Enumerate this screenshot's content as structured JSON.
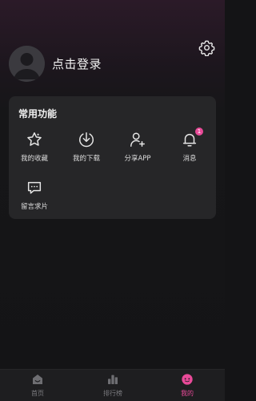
{
  "header": {
    "login_label": "点击登录"
  },
  "features": {
    "title": "常用功能",
    "items": [
      {
        "label": "我的收藏",
        "icon": "star-icon"
      },
      {
        "label": "我的下载",
        "icon": "download-icon"
      },
      {
        "label": "分享APP",
        "icon": "add-user-icon"
      },
      {
        "label": "消息",
        "icon": "bell-icon",
        "badge": "1"
      },
      {
        "label": "留言求片",
        "icon": "message-icon"
      }
    ]
  },
  "tabbar": {
    "tabs": [
      {
        "label": "首页",
        "icon": "home-icon",
        "active": false
      },
      {
        "label": "排行榜",
        "icon": "ranking-icon",
        "active": false
      },
      {
        "label": "我的",
        "icon": "profile-icon",
        "active": true
      }
    ]
  },
  "colors": {
    "accent": "#e84a98",
    "card": "#262628",
    "background": "#141416"
  }
}
